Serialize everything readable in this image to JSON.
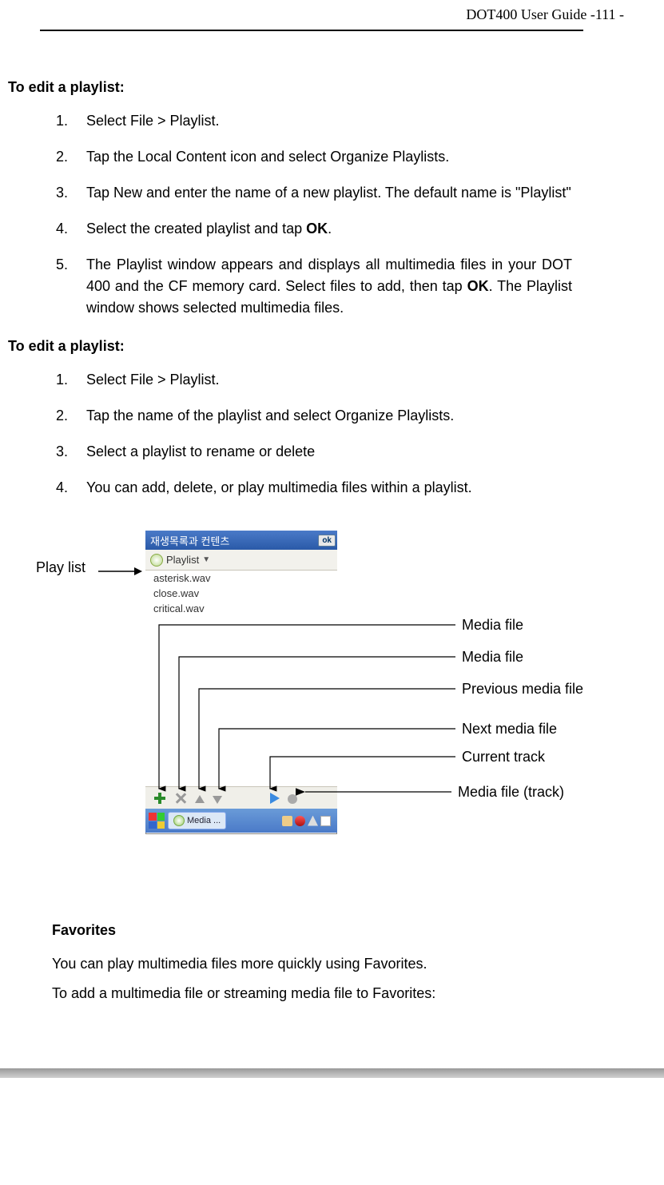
{
  "header": {
    "text": "DOT400 User Guide    -111 -"
  },
  "section1": {
    "title": "To edit a playlist:",
    "items": [
      {
        "n": "1.",
        "t": "Select File > Playlist."
      },
      {
        "n": "2.",
        "t": "Tap the Local Content icon and select Organize Playlists."
      },
      {
        "n": "3.",
        "t": "Tap New and enter the name of a new playlist. The default name is \"Playlist\""
      },
      {
        "n": "4.",
        "pre": "Select the created playlist and tap ",
        "bold": "OK",
        "post": "."
      },
      {
        "n": "5.",
        "pre": "The Playlist window appears and displays all multimedia files in your DOT 400 and the CF memory card. Select files to add, then tap ",
        "bold": "OK",
        "post": ". The Playlist window shows selected multimedia files."
      }
    ]
  },
  "section2": {
    "title": "To edit a playlist:",
    "items": [
      {
        "n": "1.",
        "t": "Select File > Playlist."
      },
      {
        "n": "2.",
        "t": "Tap the name of the playlist and select Organize Playlists."
      },
      {
        "n": "3.",
        "t": "Select a playlist to rename or delete"
      },
      {
        "n": "4.",
        "t": "You can add, delete, or play multimedia files within a playlist."
      }
    ]
  },
  "figure": {
    "left_label": "Play list",
    "titlebar": "재생목록과 컨텐츠",
    "ok": "ok",
    "dropdown_label": "Playlist",
    "files": [
      "asterisk.wav",
      "close.wav",
      "critical.wav"
    ],
    "taskbar_app": "Media ...",
    "labels": {
      "l1": "Media file",
      "l2": "Media file",
      "l3": "Previous media file",
      "l4": "Next media file",
      "l5": "Current track",
      "l6": "Media file (track)"
    }
  },
  "favorites": {
    "title": "Favorites",
    "p1": "You can play multimedia files more quickly using Favorites.",
    "p2": "To add a multimedia file or streaming media file to Favorites:"
  }
}
